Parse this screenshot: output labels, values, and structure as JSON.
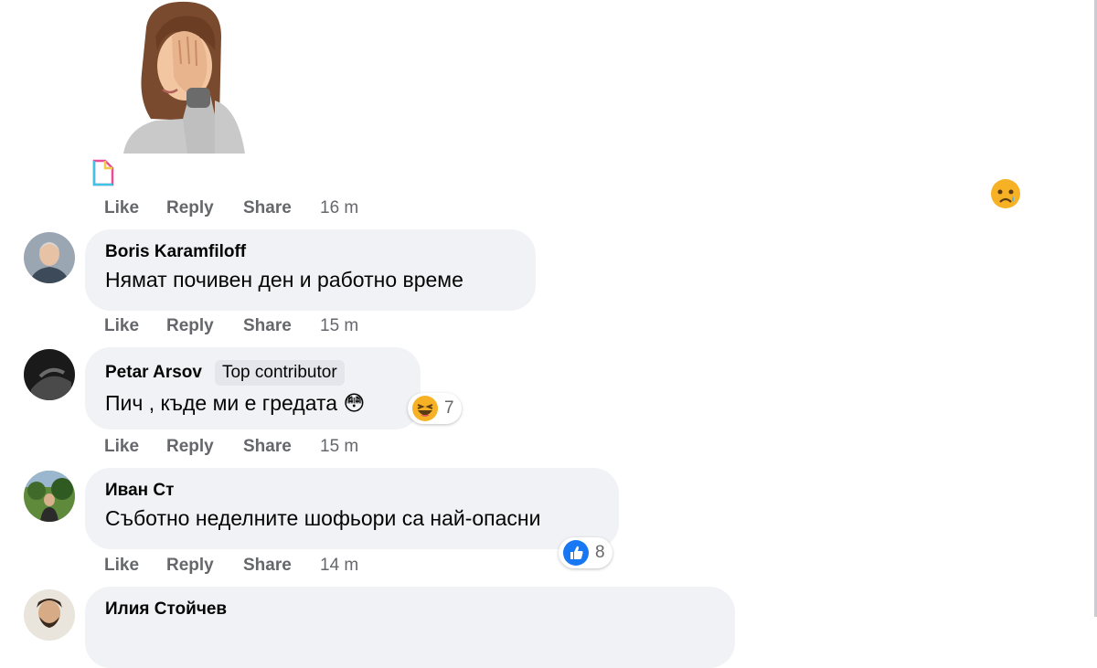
{
  "first_comment": {
    "sticker": "facepalm-woman-sticker",
    "actions": {
      "like": "Like",
      "reply": "Reply",
      "share": "Share",
      "time": "16 m"
    },
    "floating_reaction": "sad-tear-emoji"
  },
  "comments": [
    {
      "author": "Boris Karamfiloff",
      "text": "Нямат почивен ден и работно време",
      "actions": {
        "like": "Like",
        "reply": "Reply",
        "share": "Share",
        "time": "15 m"
      }
    },
    {
      "author": "Petar Arsov",
      "badge": "Top contributor",
      "text": "Пич , къде ми е гредата 😳",
      "reaction_icon": "laughing-emoji",
      "reaction_count": "7",
      "actions": {
        "like": "Like",
        "reply": "Reply",
        "share": "Share",
        "time": "15 m"
      }
    },
    {
      "author": "Иван Ст",
      "text": "Съботно неделните шофьори са най-опасни",
      "reaction_icon": "like-thumb-icon",
      "reaction_count": "8",
      "actions": {
        "like": "Like",
        "reply": "Reply",
        "share": "Share",
        "time": "14 m"
      }
    },
    {
      "author": "Илия Стойчев"
    }
  ],
  "colors": {
    "bubble": "#f0f2f5",
    "meta": "#65676b",
    "like_blue": "#1877f2",
    "laugh_yellow": "#f7b125"
  }
}
